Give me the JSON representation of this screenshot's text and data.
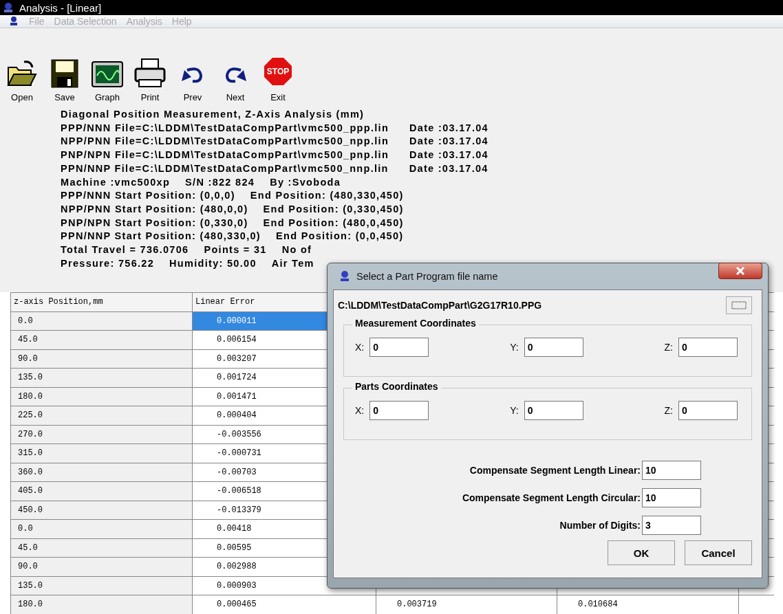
{
  "window": {
    "title": "Analysis - [Linear]"
  },
  "menu": [
    {
      "label": "File"
    },
    {
      "label": "Data Selection"
    },
    {
      "label": "Analysis"
    },
    {
      "label": "Help"
    }
  ],
  "toolbar": [
    {
      "kind": "open",
      "label": "Open"
    },
    {
      "kind": "save",
      "label": "Save"
    },
    {
      "kind": "graph",
      "label": "Graph"
    },
    {
      "kind": "print",
      "label": "Print"
    },
    {
      "kind": "prev",
      "label": "Prev"
    },
    {
      "kind": "next",
      "label": "Next"
    },
    {
      "kind": "exit",
      "label": "Exit",
      "icon_text": "STOP"
    }
  ],
  "info_lines": [
    [
      {
        "text": "Diagonal Position Measurement, Z-Axis Analysis (mm)"
      }
    ],
    [
      {
        "text": "PPP/NNN File=C:\\LDDM\\TestDataCompPart\\vmc500_ppp.lin"
      },
      {
        "text": "Date :03.17.04"
      }
    ],
    [
      {
        "text": "NPP/PNN File=C:\\LDDM\\TestDataCompPart\\vmc500_npp.lin"
      },
      {
        "text": "Date :03.17.04"
      }
    ],
    [
      {
        "text": "PNP/NPN File=C:\\LDDM\\TestDataCompPart\\vmc500_pnp.lin"
      },
      {
        "text": "Date :03.17.04"
      }
    ],
    [
      {
        "text": "PPN/NNP File=C:\\LDDM\\TestDataCompPart\\vmc500_nnp.lin"
      },
      {
        "text": "Date :03.17.04"
      }
    ],
    [
      {
        "text": "Machine :vmc500xp"
      },
      {
        "text": "S/N :822 824"
      },
      {
        "text": "By  :Svoboda"
      }
    ],
    [
      {
        "text": "PPP/NNN Start Position: (0,0,0)"
      },
      {
        "text": "End Position:   (480,330,450)"
      }
    ],
    [
      {
        "text": "NPP/PNN Start Position: (480,0,0)"
      },
      {
        "text": "End Position:   (0,330,450)"
      }
    ],
    [
      {
        "text": "PNP/NPN Start Position: (0,330,0)"
      },
      {
        "text": "End Position:   (480,0,450)"
      }
    ],
    [
      {
        "text": "PPN/NNP Start Position: (480,330,0)"
      },
      {
        "text": "End Position:   (0,0,450)"
      }
    ],
    [
      {
        "text": "Total Travel = 736.0706"
      },
      {
        "text": "Points = 31"
      },
      {
        "text": "No of"
      }
    ],
    [
      {
        "text": "Pressure: 756.22"
      },
      {
        "text": "Humidity: 50.00"
      },
      {
        "text": "Air Tem"
      }
    ]
  ],
  "table": {
    "columns": [
      "z-axis Position,mm",
      "Linear Error"
    ],
    "rows": [
      {
        "selected": true,
        "cells": [
          "0.0",
          "0.000011"
        ]
      },
      {
        "selected": false,
        "cells": [
          "45.0",
          "0.006154"
        ]
      },
      {
        "selected": false,
        "cells": [
          "90.0",
          "0.003207"
        ]
      },
      {
        "selected": false,
        "cells": [
          "135.0",
          "0.001724"
        ]
      },
      {
        "selected": false,
        "cells": [
          "180.0",
          "0.001471"
        ]
      },
      {
        "selected": false,
        "cells": [
          "225.0",
          "0.000404"
        ]
      },
      {
        "selected": false,
        "cells": [
          "270.0",
          "-0.003556"
        ]
      },
      {
        "selected": false,
        "cells": [
          "315.0",
          "-0.000731"
        ]
      },
      {
        "selected": false,
        "cells": [
          "360.0",
          "-0.00703"
        ]
      },
      {
        "selected": false,
        "cells": [
          "405.0",
          "-0.006518"
        ]
      },
      {
        "selected": false,
        "cells": [
          "450.0",
          "-0.013379"
        ]
      },
      {
        "selected": false,
        "cells": [
          "0.0",
          "0.00418"
        ]
      },
      {
        "selected": false,
        "cells": [
          "45.0",
          "0.00595"
        ]
      },
      {
        "selected": false,
        "cells": [
          "90.0",
          "0.002988"
        ]
      },
      {
        "selected": false,
        "cells": [
          "135.0",
          "0.000903"
        ]
      },
      {
        "selected": false,
        "cells": [
          "180.0",
          "0.000465",
          "0.003719",
          "0.010684"
        ]
      }
    ]
  },
  "dialog": {
    "title": "Select a Part Program file name",
    "path": "C:\\LDDM\\TestDataCompPart\\G2G17R10.PPG",
    "groups": [
      {
        "title": "Measurement Coordinates",
        "fields": [
          {
            "label": "X:",
            "value": "0"
          },
          {
            "label": "Y:",
            "value": "0"
          },
          {
            "label": "Z:",
            "value": "0"
          }
        ]
      },
      {
        "title": "Parts Coordinates",
        "fields": [
          {
            "label": "X:",
            "value": "0"
          },
          {
            "label": "Y:",
            "value": "0"
          },
          {
            "label": "Z:",
            "value": "0"
          }
        ]
      }
    ],
    "settings": [
      {
        "label": "Compensate Segment Length Linear:",
        "value": "10"
      },
      {
        "label": "Compensate Segment Length Circular:",
        "value": "10"
      },
      {
        "label": "Number of Digits:",
        "value": "3"
      }
    ],
    "buttons": [
      "OK",
      "Cancel"
    ]
  }
}
